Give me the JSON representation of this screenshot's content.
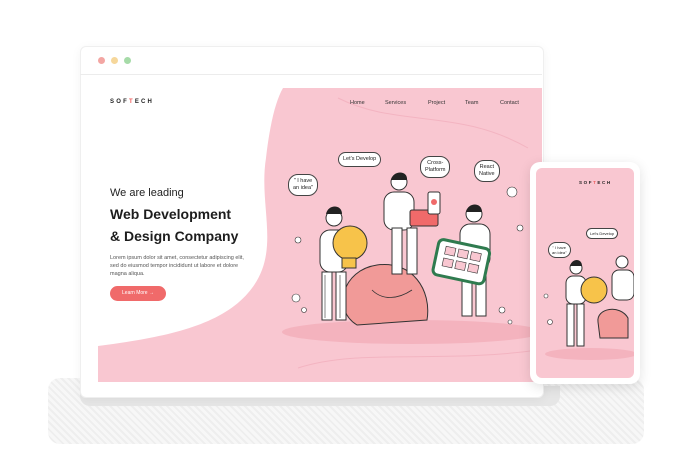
{
  "window": {
    "controls": [
      "close",
      "minimize",
      "maximize"
    ]
  },
  "header": {
    "logo_prefix": "SOF",
    "logo_accent": "T",
    "logo_suffix": "ECH",
    "nav": [
      "Home",
      "Services",
      "Project",
      "Team",
      "Contact"
    ]
  },
  "hero": {
    "eyebrow": "We are leading",
    "title_line1": "Web Development",
    "title_line2": "& Design Company",
    "body_line1": "Lorem ipsum dolor sit amet, consectetur adipiscing elit,",
    "body_line2": "sed do eiusmod tempor incididunt ut labore et dolore",
    "body_line3": "magna aliqua.",
    "cta_label": "Learn More",
    "cta_arrow": "→"
  },
  "illustration": {
    "bubble_idea_1": "\" I have",
    "bubble_idea_2": "an idea\"",
    "bubble_develop": "Let's Develop",
    "bubble_cross_1": "Cross-",
    "bubble_cross_2": "Platform",
    "bubble_react_1": "React",
    "bubble_react_2": "Native"
  },
  "mobile": {
    "logo_prefix": "SOF",
    "logo_accent": "T",
    "logo_suffix": "ECH",
    "bubble_develop": "Let's Develop",
    "bubble_idea_1": "\" I have",
    "bubble_idea_2": "an idea\""
  },
  "colors": {
    "accent": "#f06a6a",
    "hero_pink": "#f9c7d1",
    "blob": "#f19a98",
    "bulb": "#f7c34a",
    "device_green": "#2f7b4f"
  }
}
